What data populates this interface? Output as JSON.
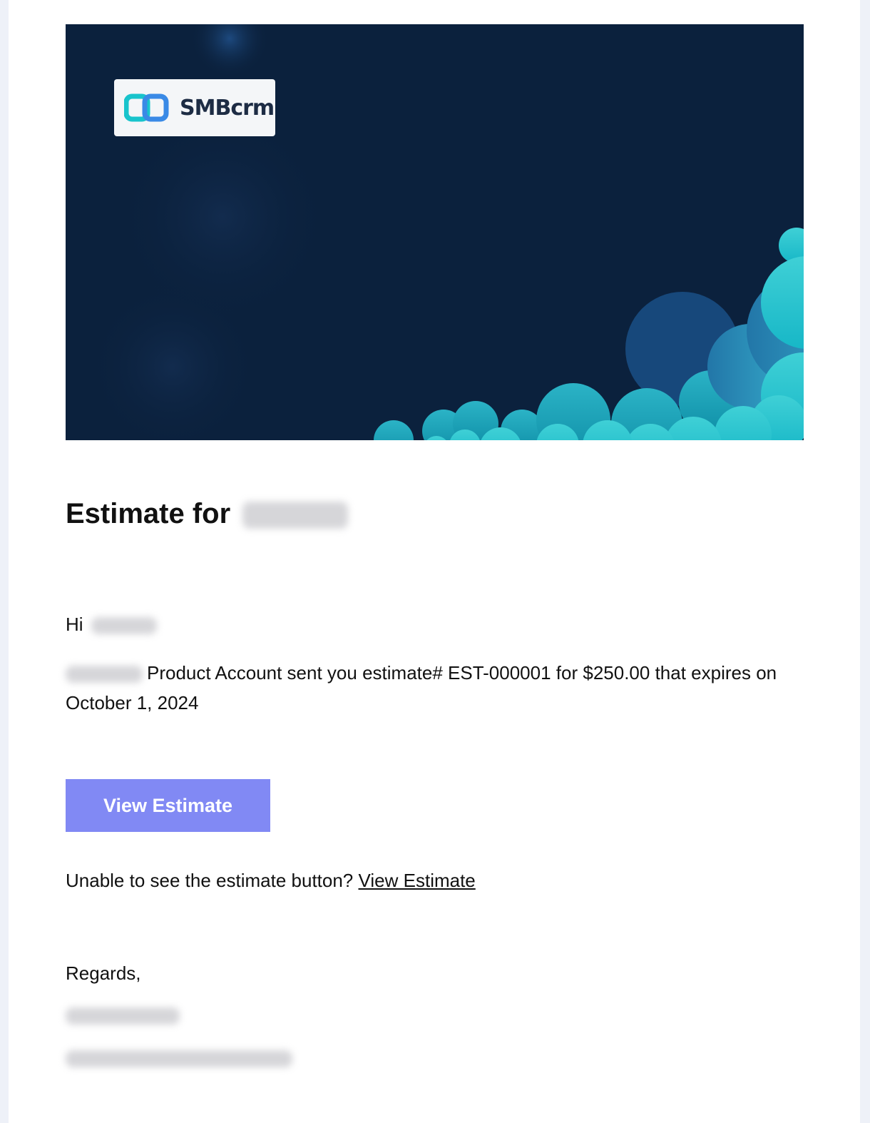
{
  "brand": {
    "name": "SMBcrm",
    "accent": "#8189f4",
    "banner_bg": "#0b213d",
    "logo_icon": "chain-link-icon"
  },
  "email": {
    "title_prefix": "Estimate for",
    "greeting_prefix": "Hi",
    "message_main": "Product Account sent you estimate# EST-000001 for $250.00 that expires on October 1, 2024",
    "button_label": "View Estimate",
    "fallback_text": "Unable to see the estimate button?",
    "fallback_link": "View Estimate",
    "regards": "Regards,"
  }
}
